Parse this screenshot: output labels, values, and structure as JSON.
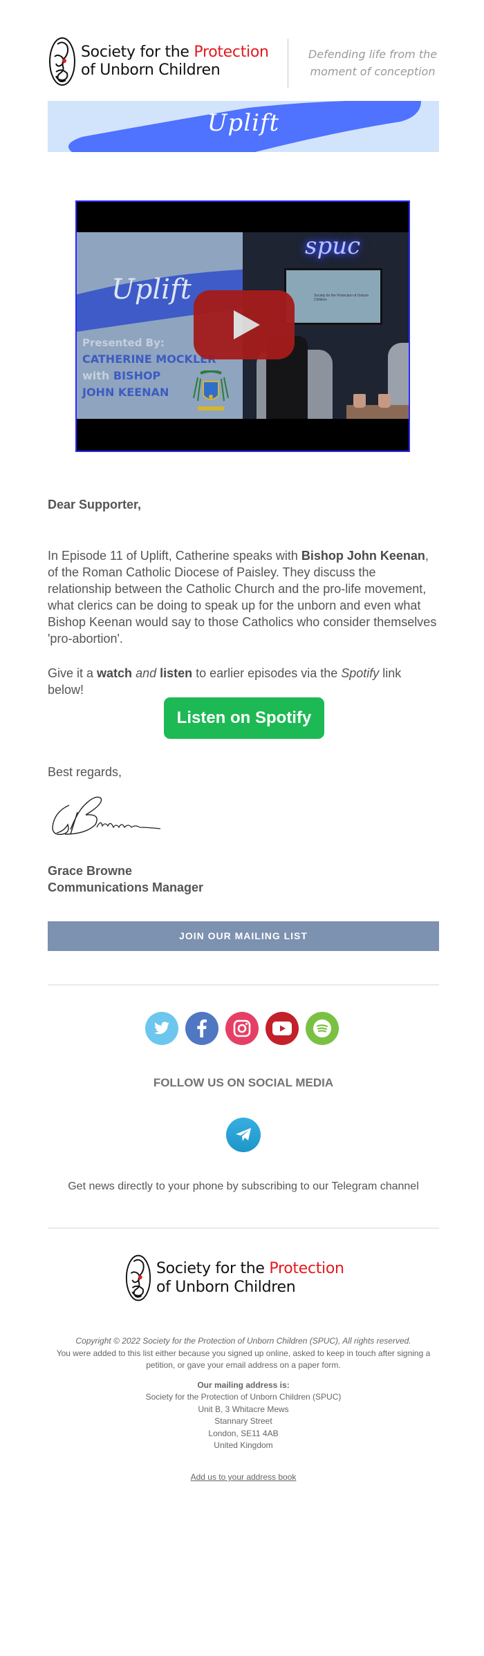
{
  "header": {
    "org_line1_black": "Society for the ",
    "org_line1_red": "Protection",
    "org_line2": "of Unborn Children",
    "tagline_line1": "Defending life from the",
    "tagline_line2": "moment of conception"
  },
  "banner": {
    "title": "Uplift"
  },
  "video": {
    "thumb_title": "Uplift",
    "presented_by": "Presented By:",
    "presenter": "CATHERINE MOCKLER",
    "with": "with",
    "guest_line1": "BISHOP",
    "guest_line2": "JOHN KEENAN",
    "neon_sign": "spuc",
    "screen_text": "Society for the Protection of Unborn Children",
    "play_label": "Play video"
  },
  "letter": {
    "greeting": "Dear Supporter,",
    "para1_a": "In Episode 11 of Uplift, Catherine speaks with ",
    "para1_bold": "Bishop John Keenan",
    "para1_b": ", of the Roman Catholic Diocese of Paisley. They discuss the relationship between the Catholic Church and the pro-life movement, what clerics can be doing to speak up for the unborn and even what Bishop Keenan would say to those Catholics who consider themselves 'pro-abortion'.",
    "para2_a": "Give it a ",
    "para2_watch": "watch",
    "para2_and": "and",
    "para2_listen": "listen",
    "para2_b": " to earlier episodes via the ",
    "para2_spotify": "Spotify",
    "para2_c": " link below!",
    "spotify_button": "Listen on Spotify",
    "closing": "Best regards,",
    "signer_name": "Grace Browne",
    "signer_title": "Communications Manager"
  },
  "mailing_list_button": "JOIN OUR MAILING LIST",
  "social": {
    "icons": [
      {
        "name": "twitter",
        "color": "#6cc6ee"
      },
      {
        "name": "facebook",
        "color": "#4f77c2"
      },
      {
        "name": "instagram",
        "color": "#e63f66"
      },
      {
        "name": "youtube",
        "color": "#c3202a"
      },
      {
        "name": "spotify",
        "color": "#7ac143"
      }
    ],
    "follow_label": "FOLLOW US ON SOCIAL MEDIA",
    "telegram_text": "Get news directly to your phone by subscribing to our Telegram channel"
  },
  "footer": {
    "copyright": "Copyright © 2022 Society for the Protection of Unborn Children (SPUC), All rights reserved.",
    "reason": "You were added to this list either because you signed up online, asked to keep in touch after signing a petition, or gave your email address on a paper form.",
    "address_label": "Our mailing address is:",
    "address_lines": [
      "Society for the Protection of Unborn Children (SPUC)",
      "Unit B, 3 Whitacre Mews",
      "Stannary Street",
      "London, SE11 4AB",
      "United Kingdom"
    ],
    "address_book_link": "Add us to your address book"
  },
  "colors": {
    "brand_red": "#e3191d",
    "spotify_green": "#1db954",
    "mailing_button": "#7d91b0",
    "banner_bg": "#d2e4fb",
    "banner_brush": "#4f72ff"
  }
}
